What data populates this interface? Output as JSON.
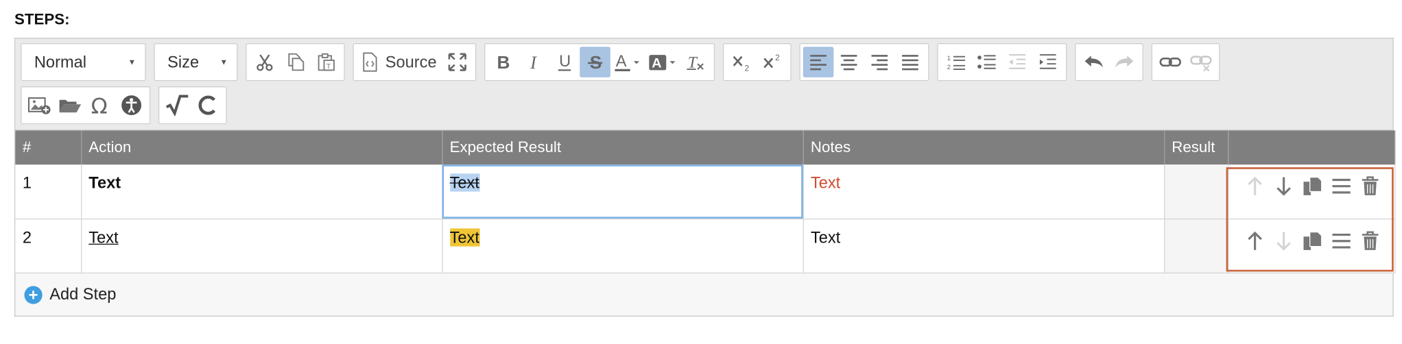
{
  "section_title": "STEPS:",
  "toolbar": {
    "format_label": "Normal",
    "size_label": "Size",
    "source_label": "Source"
  },
  "table": {
    "headers": [
      "#",
      "Action",
      "Expected Result",
      "Notes",
      "Result",
      ""
    ],
    "rows": [
      {
        "num": "1",
        "action": "Text",
        "expected": "Text",
        "notes": "Text",
        "result": ""
      },
      {
        "num": "2",
        "action": "Text",
        "expected": "Text",
        "notes": "Text",
        "result": ""
      }
    ]
  },
  "add_step_label": "Add Step",
  "colors": {
    "header_bg": "#7f7f7f",
    "active_button": "#a9c3e2",
    "highlight_yellow": "#f0c536",
    "notes_red": "#d04a2f",
    "actions_outline": "#c8643b",
    "add_icon": "#3e9ee0"
  }
}
